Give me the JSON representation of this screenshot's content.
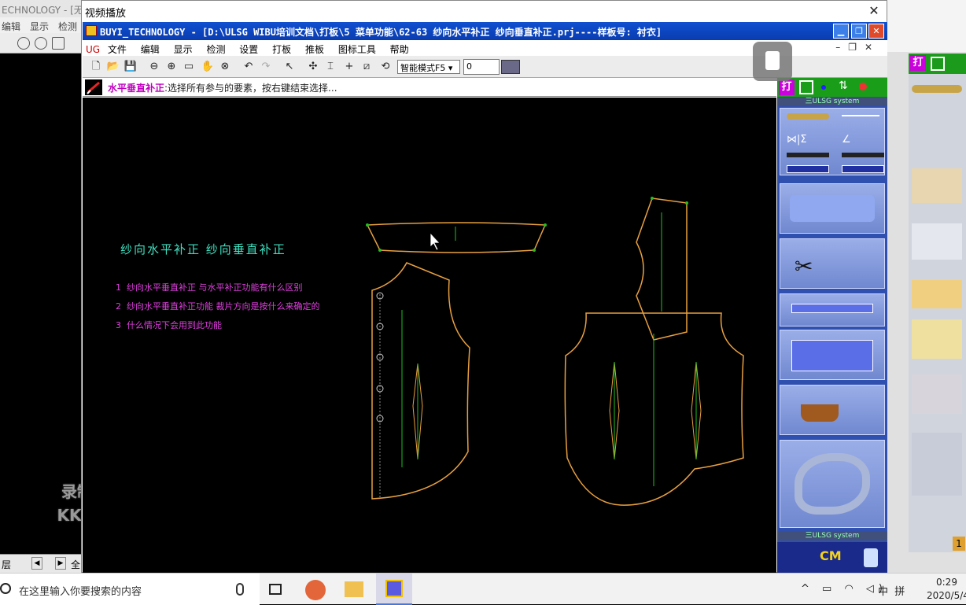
{
  "background_app": {
    "title": "ECHNOLOGY - [无",
    "menu": [
      "编辑",
      "显示",
      "检测"
    ],
    "bottom_layer": "层",
    "bottom_full": "全"
  },
  "watermark": {
    "line1": "录制工具",
    "line2": "KK录像机"
  },
  "video_window": {
    "title": "视频播放",
    "close_glyph": "✕"
  },
  "app_window": {
    "title": "BUYI_TECHNOLOGY - [D:\\ULSG WIBU培训文档\\打板\\5 菜单功能\\62-63 纱向水平补正  纱向垂直补正.prj----样板号: 衬衣]",
    "menu": {
      "logo": "UG",
      "items": [
        "文件",
        "编辑",
        "显示",
        "检测",
        "设置",
        "打板",
        "推板",
        "图标工具",
        "帮助"
      ]
    },
    "toolbar": {
      "mode_value": "智能模式F5",
      "number_value": "0"
    },
    "prompt": {
      "command": "水平垂直补正",
      "text": ":选择所有参与的要素，按右键结束选择..."
    }
  },
  "canvas": {
    "heading": "纱向水平补正 纱向垂直补正",
    "notes": [
      {
        "num": "1",
        "text": "纱向水平垂直补正  与水平补正功能有什么区别"
      },
      {
        "num": "2",
        "text": "纱向水平垂直补正功能  裁片方向是按什么来确定的"
      },
      {
        "num": "3",
        "text": "什么情况下会用到此功能"
      }
    ],
    "colors": {
      "outline": "#e8a040",
      "grain": "#20c020",
      "heading": "#40e0c0",
      "notes": "#e040e0"
    }
  },
  "palette": {
    "top_label": "打",
    "banner": "三ULSG system",
    "banner_bottom": "三ULSG system",
    "cm_label": "CM"
  },
  "right_strip": {
    "top_label": "打",
    "bottom_badge": "1"
  },
  "taskbar": {
    "search_placeholder": "在这里输入你要搜索的内容",
    "ime": "中",
    "ime2": "拼",
    "time": "0:29",
    "date": "2020/5/4"
  }
}
